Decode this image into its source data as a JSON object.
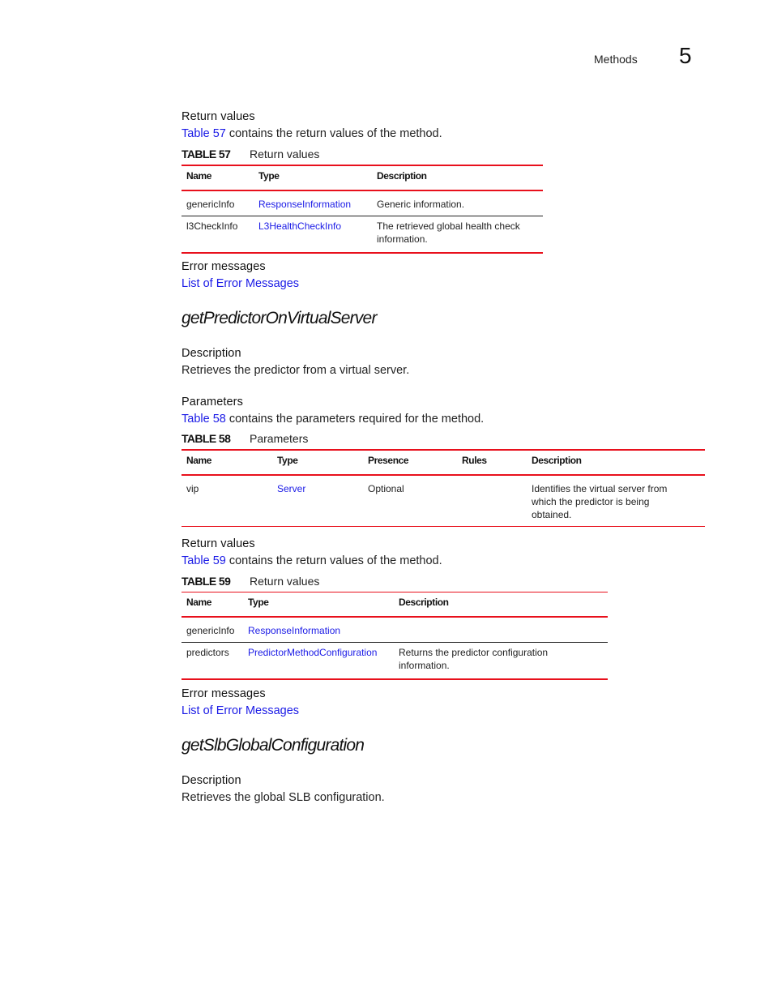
{
  "header": {
    "section": "Methods",
    "chapter": "5"
  },
  "block1": {
    "return_values_heading": "Return values",
    "intro_link": "Table 57",
    "intro_text": " contains the return values of the method.",
    "table": {
      "number": "TABLE 57",
      "title": "Return values",
      "columns": [
        "Name",
        "Type",
        "Description"
      ],
      "rows": [
        {
          "name": "genericInfo",
          "type": "ResponseInformation",
          "description": "Generic information."
        },
        {
          "name": "l3CheckInfo",
          "type": "L3HealthCheckInfo",
          "description": "The retrieved global health check information."
        }
      ]
    },
    "error_heading": "Error messages",
    "error_link": "List of Error Messages"
  },
  "method1": {
    "title": "getPredictorOnVirtualServer",
    "description_heading": "Description",
    "description_text": "Retrieves the predictor from a virtual server.",
    "parameters_heading": "Parameters",
    "params_intro_link": "Table 58",
    "params_intro_text": " contains the parameters required for the method.",
    "params_table": {
      "number": "TABLE 58",
      "title": "Parameters",
      "columns": [
        "Name",
        "Type",
        "Presence",
        "Rules",
        "Description"
      ],
      "rows": [
        {
          "name": "vip",
          "type": "Server",
          "presence": "Optional",
          "rules": "",
          "description": "Identifies the virtual server from which the predictor is being obtained."
        }
      ]
    },
    "return_values_heading": "Return values",
    "return_intro_link": "Table 59",
    "return_intro_text": " contains the return values of the method.",
    "return_table": {
      "number": "TABLE 59",
      "title": "Return values",
      "columns": [
        "Name",
        "Type",
        "Description"
      ],
      "rows": [
        {
          "name": "genericInfo",
          "type": "ResponseInformation",
          "description": ""
        },
        {
          "name": "predictors",
          "type": "PredictorMethodConfiguration",
          "description": "Returns the predictor configuration information."
        }
      ]
    },
    "error_heading": "Error messages",
    "error_link": "List of Error Messages"
  },
  "method2": {
    "title": "getSlbGlobalConfiguration",
    "description_heading": "Description",
    "description_text": "Retrieves the global SLB configuration."
  }
}
